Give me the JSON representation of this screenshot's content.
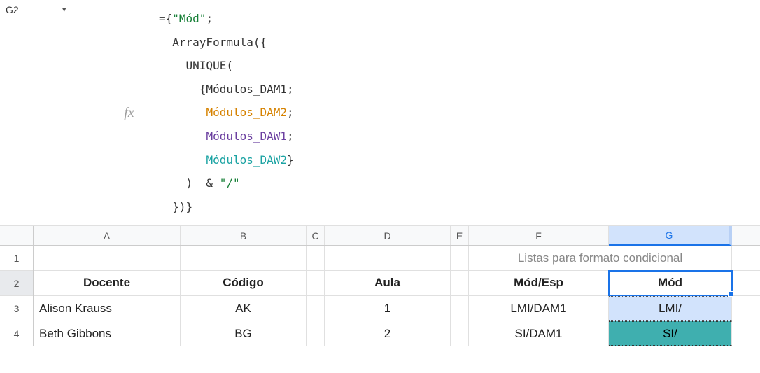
{
  "nameBox": {
    "ref": "G2"
  },
  "fxLabel": "fx",
  "formula": {
    "l1a": "={",
    "l1b": "\"Mód\"",
    "l1c": ";",
    "l2": "  ArrayFormula({",
    "l3": "    UNIQUE(",
    "l4": "      {Módulos_DAM1;",
    "l5pad": "       ",
    "l5": "Módulos_DAM2",
    "l5end": ";",
    "l6pad": "       ",
    "l6": "Módulos_DAW1",
    "l6end": ";",
    "l7pad": "       ",
    "l7": "Módulos_DAW2",
    "l7end": "}",
    "l8a": "    )  & ",
    "l8b": "\"/\"",
    "l9": "  })}"
  },
  "columns": {
    "A": "A",
    "B": "B",
    "C": "C",
    "D": "D",
    "E": "E",
    "F": "F",
    "G": "G"
  },
  "rows": {
    "r1": "1",
    "r2": "2",
    "r3": "3",
    "r4": "4"
  },
  "titleMerged": "Listas para formato condicional",
  "headers": {
    "A": "Docente",
    "B": "Código",
    "D": "Aula",
    "F": "Mód/Esp",
    "G": "Mód"
  },
  "row3": {
    "A": "Alison Krauss",
    "B": "AK",
    "D": "1",
    "F": "LMI/DAM1",
    "G": "LMI/"
  },
  "row4": {
    "A": "Beth Gibbons",
    "B": "BG",
    "D": "2",
    "F": "SI/DAM1",
    "G": "SI/"
  },
  "chart_data": {
    "type": "table",
    "columns": [
      "Docente",
      "Código",
      "Aula",
      "Mód/Esp",
      "Mód"
    ],
    "rows": [
      [
        "Alison Krauss",
        "AK",
        1,
        "LMI/DAM1",
        "LMI/"
      ],
      [
        "Beth Gibbons",
        "BG",
        2,
        "SI/DAM1",
        "SI/"
      ]
    ],
    "title": "Listas para formato condicional"
  }
}
